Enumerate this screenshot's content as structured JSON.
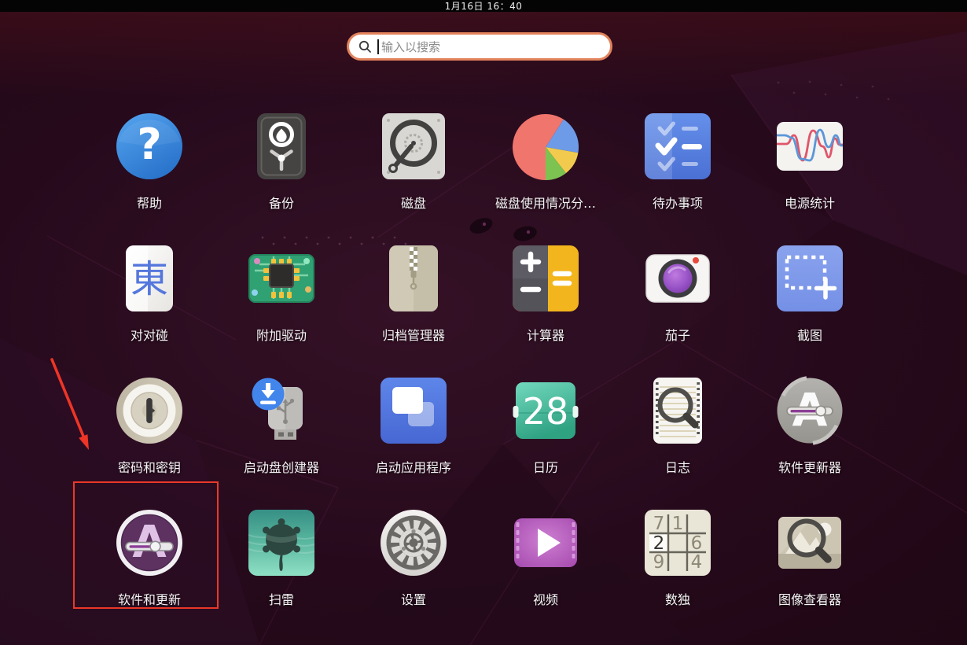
{
  "topbar": {
    "clock": "1月16日  16：40"
  },
  "search": {
    "placeholder": "输入以搜索"
  },
  "grid": {
    "columns": 6,
    "rows": 4
  },
  "colors": {
    "background_base": "#260a1c",
    "topbar_bg": "#040404",
    "search_border": "#e2835c",
    "label_text": "#f5f5f5",
    "annotation_red": "#ee3526"
  },
  "annotation": {
    "type": "arrow-and-box",
    "highlighted_app": "软件和更新",
    "color": "#ee3526"
  },
  "apps": [
    {
      "id": "help",
      "label": "帮助"
    },
    {
      "id": "backups",
      "label": "备份"
    },
    {
      "id": "disks",
      "label": "磁盘"
    },
    {
      "id": "disk-usage-analyzer",
      "label": "磁盘使用情况分…"
    },
    {
      "id": "todo",
      "label": "待办事项"
    },
    {
      "id": "power-statistics",
      "label": "电源统计"
    },
    {
      "id": "mahjongg",
      "label": "对对碰",
      "icon_text": "東"
    },
    {
      "id": "additional-drivers",
      "label": "附加驱动"
    },
    {
      "id": "archive-manager",
      "label": "归档管理器"
    },
    {
      "id": "calculator",
      "label": "计算器"
    },
    {
      "id": "cheese",
      "label": "茄子"
    },
    {
      "id": "screenshot",
      "label": "截图"
    },
    {
      "id": "passwords-keys",
      "label": "密码和密钥"
    },
    {
      "id": "startup-disk-creator",
      "label": "启动盘创建器"
    },
    {
      "id": "startup-applications",
      "label": "启动应用程序"
    },
    {
      "id": "calendar",
      "label": "日历",
      "icon_text": "28"
    },
    {
      "id": "logs",
      "label": "日志"
    },
    {
      "id": "software-updater",
      "label": "软件更新器",
      "icon_text": "A"
    },
    {
      "id": "software-and-updates",
      "label": "软件和更新",
      "icon_text": "A",
      "highlighted": true
    },
    {
      "id": "mines",
      "label": "扫雷"
    },
    {
      "id": "settings",
      "label": "设置"
    },
    {
      "id": "videos",
      "label": "视频"
    },
    {
      "id": "sudoku",
      "label": "数独",
      "cells": [
        [
          "7",
          "1",
          ""
        ],
        [
          "2",
          "",
          "6"
        ],
        [
          "9",
          "",
          "4"
        ]
      ]
    },
    {
      "id": "image-viewer",
      "label": "图像查看器"
    }
  ]
}
